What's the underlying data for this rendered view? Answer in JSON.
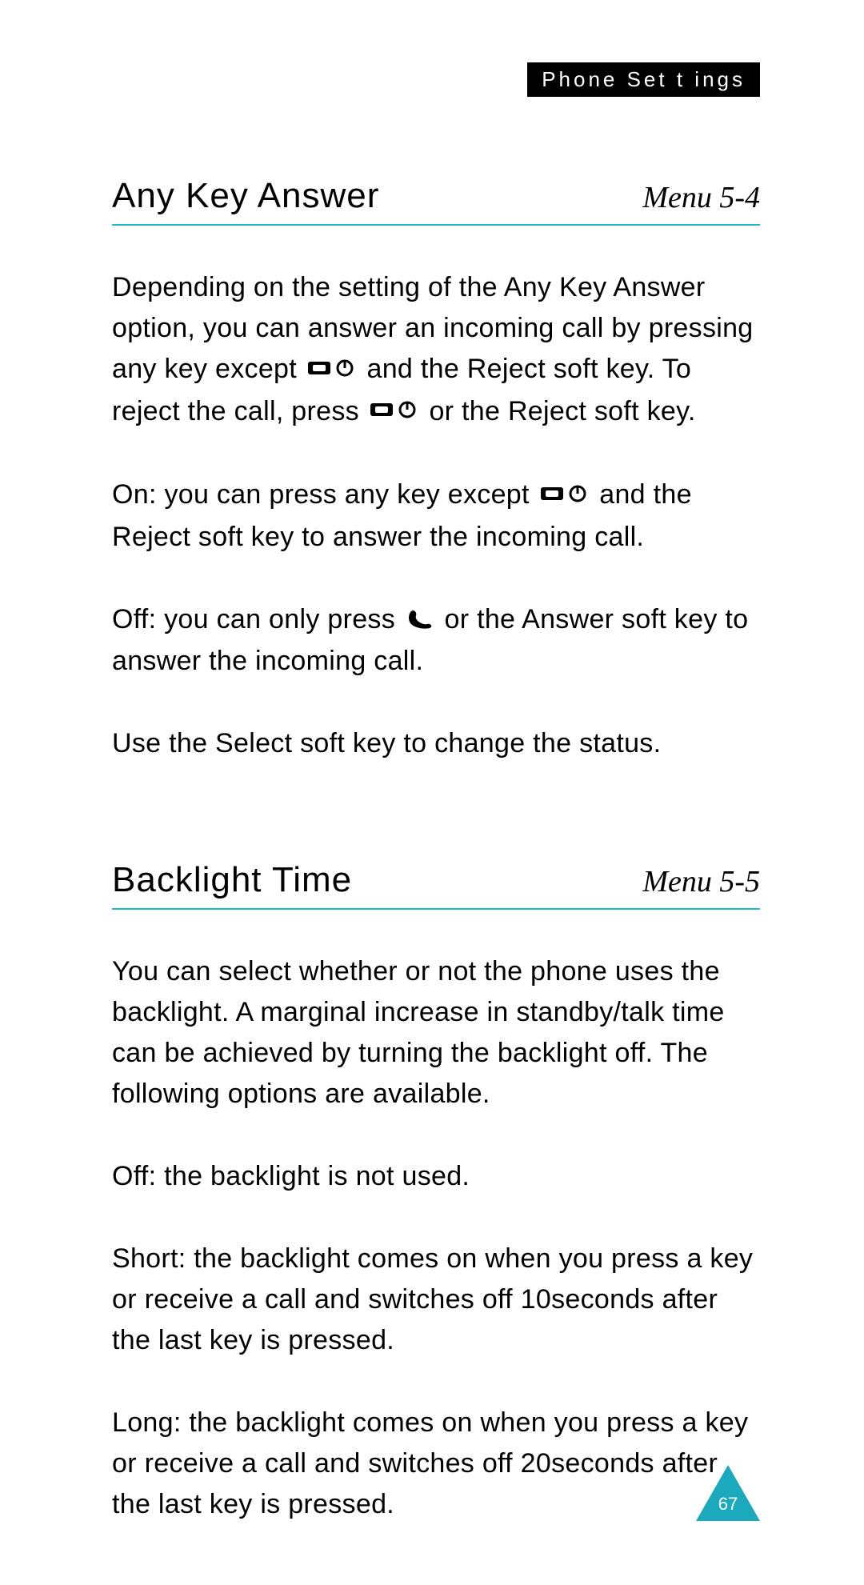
{
  "header": {
    "tag": "Phone Set t ings"
  },
  "sections": [
    {
      "title": "Any Key Answer",
      "menu": "Menu 5-4",
      "p1_a": "Depending on the setting of the ",
      "p1_term1": "Any Key Answer",
      "p1_b": " option, you can answer an incoming call by pressing any key except ",
      "p1_c": " and the ",
      "p1_term2": "Reject",
      "p1_d": " soft key. To reject the call, press ",
      "p1_e": " or the ",
      "p1_term3": "Reject",
      "p1_f": " soft key.",
      "p2_term": "On:",
      "p2_a": " you can press any key except ",
      "p2_b": " and the ",
      "p2_term2": "Reject",
      "p2_c": " soft key to answer the incoming call.",
      "p3_term": "Off:",
      "p3_a": " you can only press ",
      "p3_b": " or the ",
      "p3_term2": "Answer",
      "p3_c": " soft key to answer the incoming call.",
      "p4_a": "Use the ",
      "p4_term": "Select",
      "p4_b": " soft key to change the status."
    },
    {
      "title": "Backlight Time",
      "menu": "Menu 5-5",
      "p1": "You can select whether or not the phone uses the backlight. A marginal increase in standby/talk time can be achieved by turning the backlight off. The following options are available.",
      "p2_term": "Off:",
      "p2_a": " the backlight is not used.",
      "p3_term": "Short:",
      "p3_a": " the backlight comes on when you press a key or receive a call and switches off 10seconds after the last key is pressed.",
      "p4_term": "Long:",
      "p4_a": " the backlight comes on when you press a key or receive a call and switches off 20seconds after the last key is pressed."
    }
  ],
  "page_number": "67",
  "icons": {
    "end_key": "end-power-key-icon",
    "answer_key": "answer-call-key-icon"
  }
}
